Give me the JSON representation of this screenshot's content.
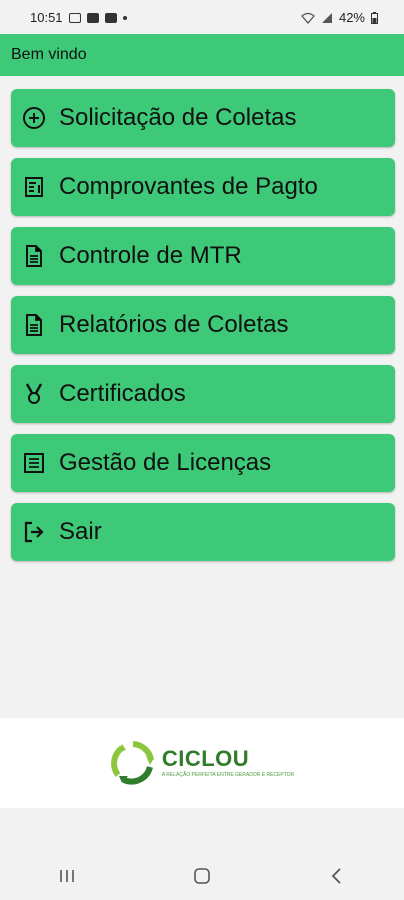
{
  "status_bar": {
    "time": "10:51",
    "battery": "42%"
  },
  "header": {
    "title": "Bem vindo"
  },
  "menu": {
    "items": [
      {
        "label": "Solicitação de Coletas",
        "icon": "add-circle-icon"
      },
      {
        "label": "Comprovantes de Pagto",
        "icon": "receipt-icon"
      },
      {
        "label": "Controle de MTR",
        "icon": "document-icon"
      },
      {
        "label": "Relatórios de Coletas",
        "icon": "document-icon"
      },
      {
        "label": "Certificados",
        "icon": "medal-icon"
      },
      {
        "label": "Gestão de Licenças",
        "icon": "list-icon"
      },
      {
        "label": "Sair",
        "icon": "logout-icon"
      }
    ]
  },
  "logo": {
    "name": "CICLOU",
    "tagline": "A RELAÇÃO PERFEITA ENTRE GERADOR E RECEPTOR",
    "colors": {
      "dark_green": "#2f7d2a",
      "light_green": "#8cc63f"
    }
  },
  "colors": {
    "accent": "#3ec978",
    "background": "#f2f2f2"
  }
}
